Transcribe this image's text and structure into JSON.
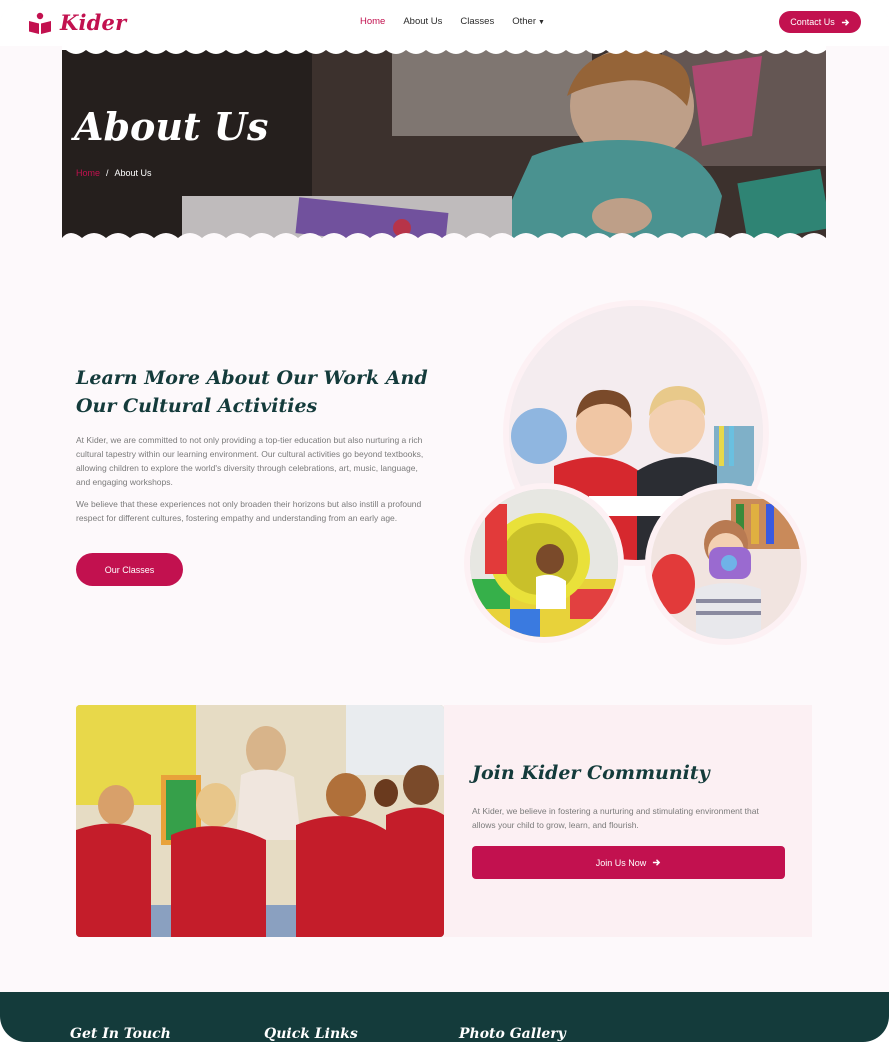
{
  "brand": {
    "name": "Kider",
    "accent": "#c2114f",
    "dark": "#143b3b"
  },
  "nav": {
    "items": [
      {
        "label": "Home",
        "active": true
      },
      {
        "label": "About Us",
        "active": false
      },
      {
        "label": "Classes",
        "active": false
      },
      {
        "label": "Other",
        "active": false
      }
    ],
    "contact_label": "Contact Us",
    "contact_icon": "arrow-right-icon"
  },
  "hero": {
    "title": "About Us",
    "breadcrumb": {
      "home": "Home",
      "separator": "/",
      "current": "About Us"
    }
  },
  "about": {
    "title": "Learn More About Our Work And Our Cultural Activities",
    "p1": "At Kider, we are committed to not only providing a top-tier education but also nurturing a rich cultural tapestry within our learning environment. Our cultural activities go beyond textbooks, allowing children to explore the world's diversity through celebrations, art, music, language, and engaging workshops.",
    "p2": "We believe that these experiences not only broaden their horizons but also instill a profound respect for different cultures, fostering empathy and understanding from an early age.",
    "button": "Our Classes"
  },
  "join": {
    "title": "Join Kider Community",
    "text": "At Kider, we believe in fostering a nurturing and stimulating environment that allows your child to grow, learn, and flourish.",
    "button": "Join Us Now"
  },
  "footer": {
    "headings": [
      "Get In Touch",
      "Quick Links",
      "Photo Gallery"
    ]
  }
}
